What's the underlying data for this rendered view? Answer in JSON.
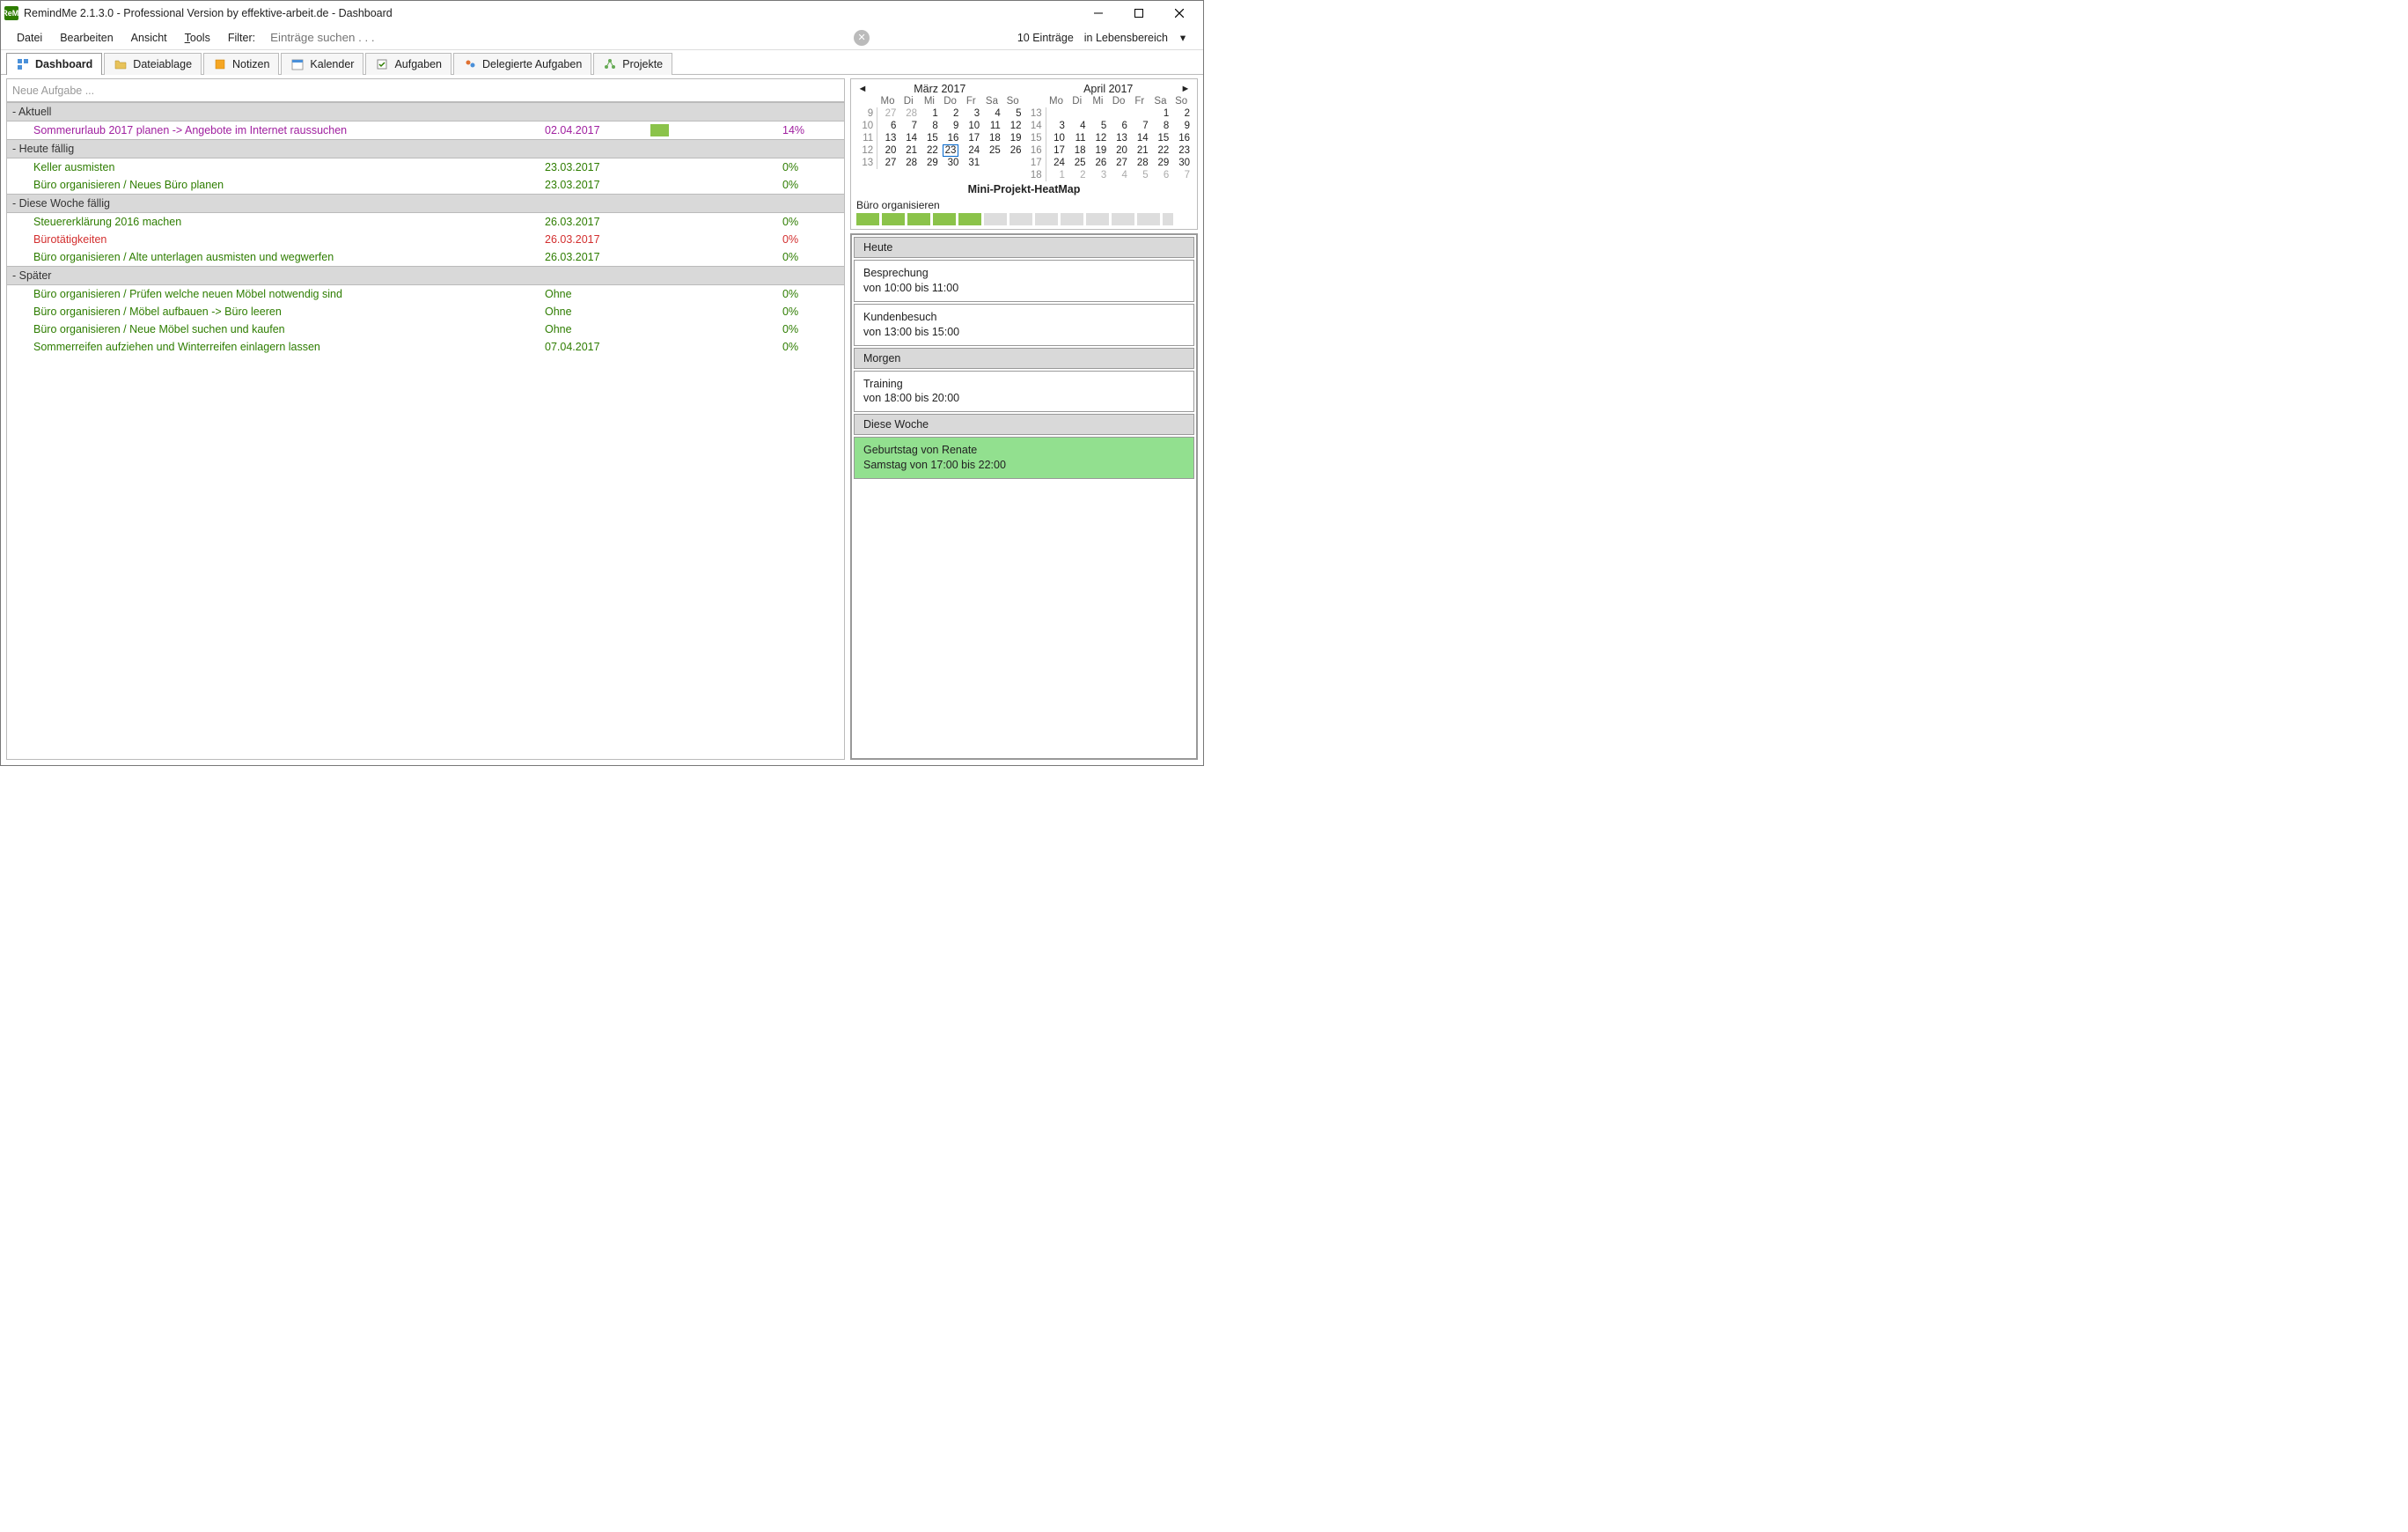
{
  "window": {
    "title": "RemindMe 2.1.3.0 - Professional Version by effektive-arbeit.de - Dashboard",
    "appicon_text": "ReMi"
  },
  "menu": {
    "datei": "Datei",
    "bearbeiten": "Bearbeiten",
    "ansicht": "Ansicht",
    "tools": "Tools",
    "filter_label": "Filter:",
    "filter_placeholder": "Einträge suchen . . .",
    "entry_count": "10 Einträge",
    "scope": "in Lebensbereich"
  },
  "tabs": {
    "dashboard": "Dashboard",
    "dateiablage": "Dateiablage",
    "notizen": "Notizen",
    "kalender": "Kalender",
    "aufgaben": "Aufgaben",
    "delegierte": "Delegierte Aufgaben",
    "projekte": "Projekte"
  },
  "newtask_placeholder": "Neue Aufgabe ...",
  "groups": {
    "aktuell": "- Aktuell",
    "heute": "- Heute fällig",
    "woche": "- Diese Woche fällig",
    "spaeter": "- Später"
  },
  "tasks": {
    "aktuell": [
      {
        "title": "Sommerurlaub 2017 planen -> Angebote im Internet raussuchen",
        "date": "02.04.2017",
        "progress": "14%",
        "bar": 14,
        "style": "purple"
      }
    ],
    "heute": [
      {
        "title": "Keller ausmisten",
        "date": "23.03.2017",
        "progress": "0%",
        "style": "green"
      },
      {
        "title": "Büro organisieren / Neues Büro planen",
        "date": "23.03.2017",
        "progress": "0%",
        "style": "green"
      }
    ],
    "woche": [
      {
        "title": "Steuererklärung 2016 machen",
        "date": "26.03.2017",
        "progress": "0%",
        "style": "green"
      },
      {
        "title": "Bürotätigkeiten",
        "date": "26.03.2017",
        "progress": "0%",
        "style": "red"
      },
      {
        "title": "Büro organisieren / Alte unterlagen ausmisten und wegwerfen",
        "date": "26.03.2017",
        "progress": "0%",
        "style": "green"
      }
    ],
    "spaeter": [
      {
        "title": "Büro organisieren / Prüfen welche neuen Möbel notwendig sind",
        "date": "Ohne",
        "progress": "0%",
        "style": "green"
      },
      {
        "title": "Büro organisieren / Möbel aufbauen -> Büro leeren",
        "date": "Ohne",
        "progress": "0%",
        "style": "green"
      },
      {
        "title": "Büro organisieren / Neue Möbel suchen und kaufen",
        "date": "Ohne",
        "progress": "0%",
        "style": "green"
      },
      {
        "title": "Sommerreifen aufziehen und Winterreifen einlagern lassen",
        "date": "07.04.2017",
        "progress": "0%",
        "style": "green"
      }
    ]
  },
  "calendar": {
    "dow": {
      "mo": "Mo",
      "di": "Di",
      "mi": "Mi",
      "do": "Do",
      "fr": "Fr",
      "sa": "Sa",
      "so": "So"
    },
    "m1": {
      "name": "März 2017",
      "weeks": [
        {
          "wk": "9",
          "d": [
            {
              "n": "27",
              "dim": true
            },
            {
              "n": "28",
              "dim": true
            },
            {
              "n": "1"
            },
            {
              "n": "2"
            },
            {
              "n": "3"
            },
            {
              "n": "4"
            },
            {
              "n": "5"
            }
          ]
        },
        {
          "wk": "10",
          "d": [
            {
              "n": "6"
            },
            {
              "n": "7"
            },
            {
              "n": "8"
            },
            {
              "n": "9"
            },
            {
              "n": "10"
            },
            {
              "n": "11"
            },
            {
              "n": "12"
            }
          ]
        },
        {
          "wk": "11",
          "d": [
            {
              "n": "13"
            },
            {
              "n": "14"
            },
            {
              "n": "15"
            },
            {
              "n": "16"
            },
            {
              "n": "17"
            },
            {
              "n": "18"
            },
            {
              "n": "19"
            }
          ]
        },
        {
          "wk": "12",
          "d": [
            {
              "n": "20"
            },
            {
              "n": "21"
            },
            {
              "n": "22"
            },
            {
              "n": "23",
              "today": true
            },
            {
              "n": "24"
            },
            {
              "n": "25"
            },
            {
              "n": "26"
            }
          ]
        },
        {
          "wk": "13",
          "d": [
            {
              "n": "27"
            },
            {
              "n": "28"
            },
            {
              "n": "29"
            },
            {
              "n": "30"
            },
            {
              "n": "31"
            },
            {
              "n": ""
            },
            {
              "n": ""
            }
          ]
        }
      ]
    },
    "m2": {
      "name": "April 2017",
      "weeks": [
        {
          "wk": "13",
          "d": [
            {
              "n": ""
            },
            {
              "n": ""
            },
            {
              "n": ""
            },
            {
              "n": ""
            },
            {
              "n": ""
            },
            {
              "n": "1"
            },
            {
              "n": "2"
            }
          ]
        },
        {
          "wk": "14",
          "d": [
            {
              "n": "3"
            },
            {
              "n": "4"
            },
            {
              "n": "5"
            },
            {
              "n": "6"
            },
            {
              "n": "7"
            },
            {
              "n": "8"
            },
            {
              "n": "9"
            }
          ]
        },
        {
          "wk": "15",
          "d": [
            {
              "n": "10"
            },
            {
              "n": "11"
            },
            {
              "n": "12"
            },
            {
              "n": "13"
            },
            {
              "n": "14"
            },
            {
              "n": "15"
            },
            {
              "n": "16"
            }
          ]
        },
        {
          "wk": "16",
          "d": [
            {
              "n": "17"
            },
            {
              "n": "18"
            },
            {
              "n": "19"
            },
            {
              "n": "20"
            },
            {
              "n": "21"
            },
            {
              "n": "22"
            },
            {
              "n": "23"
            }
          ]
        },
        {
          "wk": "17",
          "d": [
            {
              "n": "24"
            },
            {
              "n": "25"
            },
            {
              "n": "26"
            },
            {
              "n": "27"
            },
            {
              "n": "28"
            },
            {
              "n": "29"
            },
            {
              "n": "30"
            }
          ]
        },
        {
          "wk": "18",
          "d": [
            {
              "n": "1",
              "dim": true
            },
            {
              "n": "2",
              "dim": true
            },
            {
              "n": "3",
              "dim": true
            },
            {
              "n": "4",
              "dim": true
            },
            {
              "n": "5",
              "dim": true
            },
            {
              "n": "6",
              "dim": true
            },
            {
              "n": "7",
              "dim": true
            }
          ]
        }
      ]
    }
  },
  "heatmap": {
    "title": "Mini-Projekt-HeatMap",
    "label": "Büro organisieren",
    "cells": [
      true,
      true,
      true,
      true,
      true,
      false,
      false,
      false,
      false,
      false,
      false,
      false,
      false
    ]
  },
  "appointments": {
    "heute_hdr": "Heute",
    "heute": [
      {
        "title": "Besprechung",
        "time": "von 10:00 bis 11:00"
      },
      {
        "title": "Kundenbesuch",
        "time": "von 13:00 bis 15:00"
      }
    ],
    "morgen_hdr": "Morgen",
    "morgen": [
      {
        "title": "Training",
        "time": "von 18:00 bis 20:00"
      }
    ],
    "woche_hdr": "Diese Woche",
    "woche": [
      {
        "title": "Geburtstag von Renate",
        "time": "Samstag von 17:00 bis 22:00",
        "hl": true
      }
    ]
  }
}
